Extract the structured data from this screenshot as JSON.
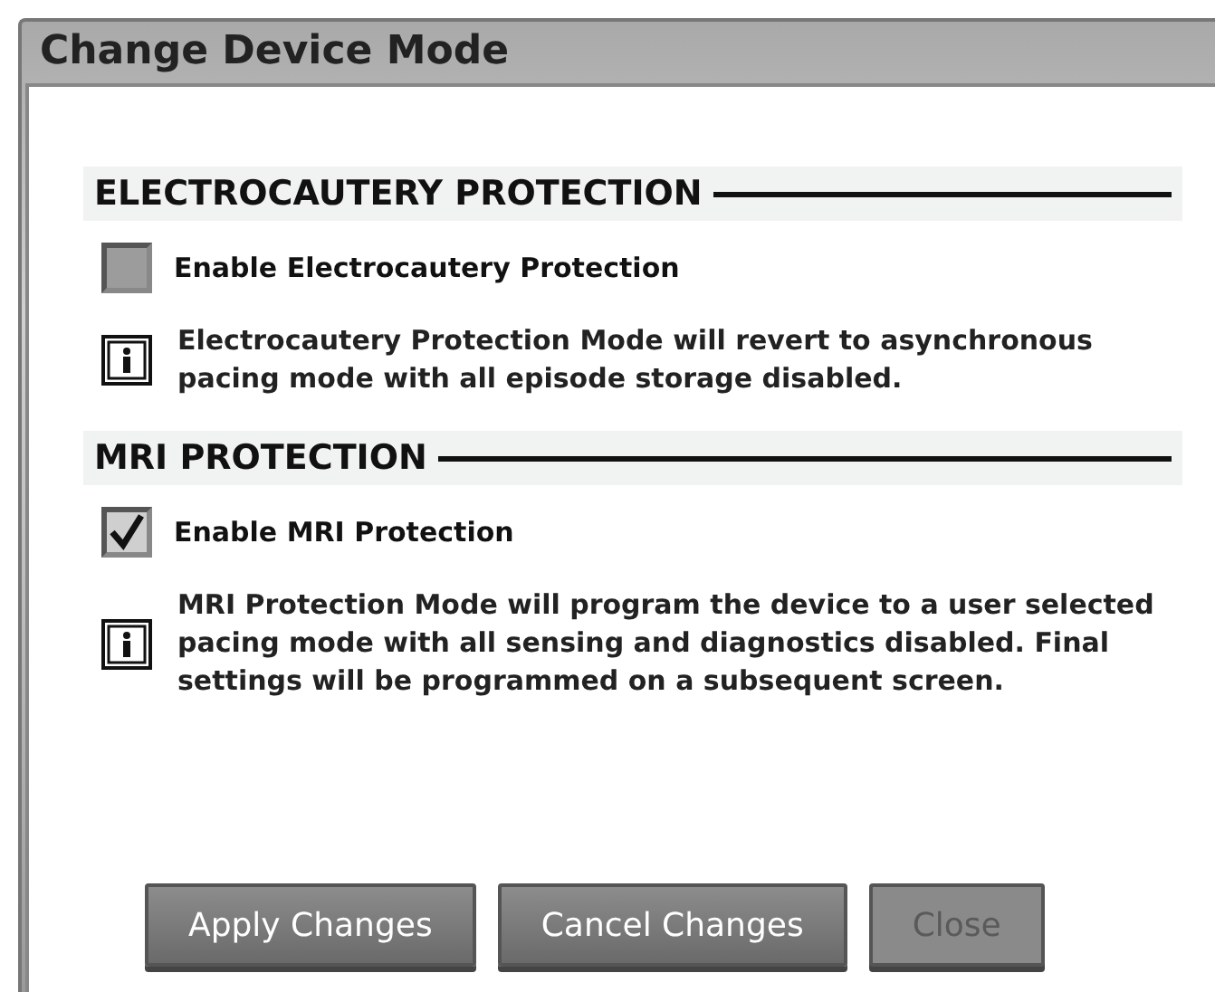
{
  "window": {
    "title": "Change Device Mode"
  },
  "sections": [
    {
      "heading": "ELECTROCAUTERY PROTECTION",
      "option": {
        "label": "Enable Electrocautery Protection",
        "checked": false
      },
      "info": "Electrocautery Protection Mode will revert to asynchronous pacing mode with all episode storage disabled."
    },
    {
      "heading": "MRI PROTECTION",
      "option": {
        "label": "Enable MRI Protection",
        "checked": true
      },
      "info": "MRI Protection Mode will program the device to a user selected pacing mode with all sensing and diagnostics disabled. Final settings will be programmed on a subsequent screen."
    }
  ],
  "buttons": [
    {
      "label": "Apply Changes",
      "disabled": false
    },
    {
      "label": "Cancel Changes",
      "disabled": false
    },
    {
      "label": "Close",
      "disabled": true
    }
  ]
}
